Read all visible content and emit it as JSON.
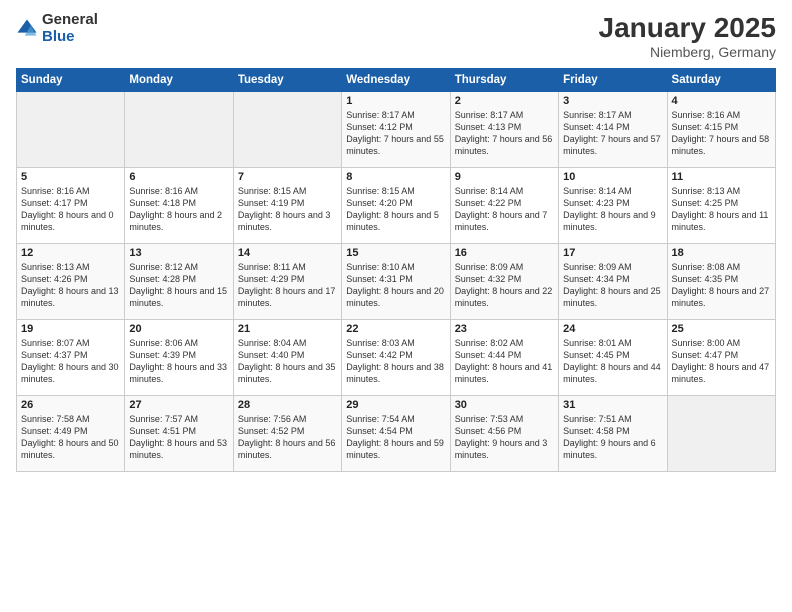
{
  "logo": {
    "general": "General",
    "blue": "Blue"
  },
  "title": "January 2025",
  "subtitle": "Niemberg, Germany",
  "weekdays": [
    "Sunday",
    "Monday",
    "Tuesday",
    "Wednesday",
    "Thursday",
    "Friday",
    "Saturday"
  ],
  "weeks": [
    [
      {
        "day": "",
        "sunrise": "",
        "sunset": "",
        "daylight": ""
      },
      {
        "day": "",
        "sunrise": "",
        "sunset": "",
        "daylight": ""
      },
      {
        "day": "",
        "sunrise": "",
        "sunset": "",
        "daylight": ""
      },
      {
        "day": "1",
        "sunrise": "Sunrise: 8:17 AM",
        "sunset": "Sunset: 4:12 PM",
        "daylight": "Daylight: 7 hours and 55 minutes."
      },
      {
        "day": "2",
        "sunrise": "Sunrise: 8:17 AM",
        "sunset": "Sunset: 4:13 PM",
        "daylight": "Daylight: 7 hours and 56 minutes."
      },
      {
        "day": "3",
        "sunrise": "Sunrise: 8:17 AM",
        "sunset": "Sunset: 4:14 PM",
        "daylight": "Daylight: 7 hours and 57 minutes."
      },
      {
        "day": "4",
        "sunrise": "Sunrise: 8:16 AM",
        "sunset": "Sunset: 4:15 PM",
        "daylight": "Daylight: 7 hours and 58 minutes."
      }
    ],
    [
      {
        "day": "5",
        "sunrise": "Sunrise: 8:16 AM",
        "sunset": "Sunset: 4:17 PM",
        "daylight": "Daylight: 8 hours and 0 minutes."
      },
      {
        "day": "6",
        "sunrise": "Sunrise: 8:16 AM",
        "sunset": "Sunset: 4:18 PM",
        "daylight": "Daylight: 8 hours and 2 minutes."
      },
      {
        "day": "7",
        "sunrise": "Sunrise: 8:15 AM",
        "sunset": "Sunset: 4:19 PM",
        "daylight": "Daylight: 8 hours and 3 minutes."
      },
      {
        "day": "8",
        "sunrise": "Sunrise: 8:15 AM",
        "sunset": "Sunset: 4:20 PM",
        "daylight": "Daylight: 8 hours and 5 minutes."
      },
      {
        "day": "9",
        "sunrise": "Sunrise: 8:14 AM",
        "sunset": "Sunset: 4:22 PM",
        "daylight": "Daylight: 8 hours and 7 minutes."
      },
      {
        "day": "10",
        "sunrise": "Sunrise: 8:14 AM",
        "sunset": "Sunset: 4:23 PM",
        "daylight": "Daylight: 8 hours and 9 minutes."
      },
      {
        "day": "11",
        "sunrise": "Sunrise: 8:13 AM",
        "sunset": "Sunset: 4:25 PM",
        "daylight": "Daylight: 8 hours and 11 minutes."
      }
    ],
    [
      {
        "day": "12",
        "sunrise": "Sunrise: 8:13 AM",
        "sunset": "Sunset: 4:26 PM",
        "daylight": "Daylight: 8 hours and 13 minutes."
      },
      {
        "day": "13",
        "sunrise": "Sunrise: 8:12 AM",
        "sunset": "Sunset: 4:28 PM",
        "daylight": "Daylight: 8 hours and 15 minutes."
      },
      {
        "day": "14",
        "sunrise": "Sunrise: 8:11 AM",
        "sunset": "Sunset: 4:29 PM",
        "daylight": "Daylight: 8 hours and 17 minutes."
      },
      {
        "day": "15",
        "sunrise": "Sunrise: 8:10 AM",
        "sunset": "Sunset: 4:31 PM",
        "daylight": "Daylight: 8 hours and 20 minutes."
      },
      {
        "day": "16",
        "sunrise": "Sunrise: 8:09 AM",
        "sunset": "Sunset: 4:32 PM",
        "daylight": "Daylight: 8 hours and 22 minutes."
      },
      {
        "day": "17",
        "sunrise": "Sunrise: 8:09 AM",
        "sunset": "Sunset: 4:34 PM",
        "daylight": "Daylight: 8 hours and 25 minutes."
      },
      {
        "day": "18",
        "sunrise": "Sunrise: 8:08 AM",
        "sunset": "Sunset: 4:35 PM",
        "daylight": "Daylight: 8 hours and 27 minutes."
      }
    ],
    [
      {
        "day": "19",
        "sunrise": "Sunrise: 8:07 AM",
        "sunset": "Sunset: 4:37 PM",
        "daylight": "Daylight: 8 hours and 30 minutes."
      },
      {
        "day": "20",
        "sunrise": "Sunrise: 8:06 AM",
        "sunset": "Sunset: 4:39 PM",
        "daylight": "Daylight: 8 hours and 33 minutes."
      },
      {
        "day": "21",
        "sunrise": "Sunrise: 8:04 AM",
        "sunset": "Sunset: 4:40 PM",
        "daylight": "Daylight: 8 hours and 35 minutes."
      },
      {
        "day": "22",
        "sunrise": "Sunrise: 8:03 AM",
        "sunset": "Sunset: 4:42 PM",
        "daylight": "Daylight: 8 hours and 38 minutes."
      },
      {
        "day": "23",
        "sunrise": "Sunrise: 8:02 AM",
        "sunset": "Sunset: 4:44 PM",
        "daylight": "Daylight: 8 hours and 41 minutes."
      },
      {
        "day": "24",
        "sunrise": "Sunrise: 8:01 AM",
        "sunset": "Sunset: 4:45 PM",
        "daylight": "Daylight: 8 hours and 44 minutes."
      },
      {
        "day": "25",
        "sunrise": "Sunrise: 8:00 AM",
        "sunset": "Sunset: 4:47 PM",
        "daylight": "Daylight: 8 hours and 47 minutes."
      }
    ],
    [
      {
        "day": "26",
        "sunrise": "Sunrise: 7:58 AM",
        "sunset": "Sunset: 4:49 PM",
        "daylight": "Daylight: 8 hours and 50 minutes."
      },
      {
        "day": "27",
        "sunrise": "Sunrise: 7:57 AM",
        "sunset": "Sunset: 4:51 PM",
        "daylight": "Daylight: 8 hours and 53 minutes."
      },
      {
        "day": "28",
        "sunrise": "Sunrise: 7:56 AM",
        "sunset": "Sunset: 4:52 PM",
        "daylight": "Daylight: 8 hours and 56 minutes."
      },
      {
        "day": "29",
        "sunrise": "Sunrise: 7:54 AM",
        "sunset": "Sunset: 4:54 PM",
        "daylight": "Daylight: 8 hours and 59 minutes."
      },
      {
        "day": "30",
        "sunrise": "Sunrise: 7:53 AM",
        "sunset": "Sunset: 4:56 PM",
        "daylight": "Daylight: 9 hours and 3 minutes."
      },
      {
        "day": "31",
        "sunrise": "Sunrise: 7:51 AM",
        "sunset": "Sunset: 4:58 PM",
        "daylight": "Daylight: 9 hours and 6 minutes."
      },
      {
        "day": "",
        "sunrise": "",
        "sunset": "",
        "daylight": ""
      }
    ]
  ]
}
